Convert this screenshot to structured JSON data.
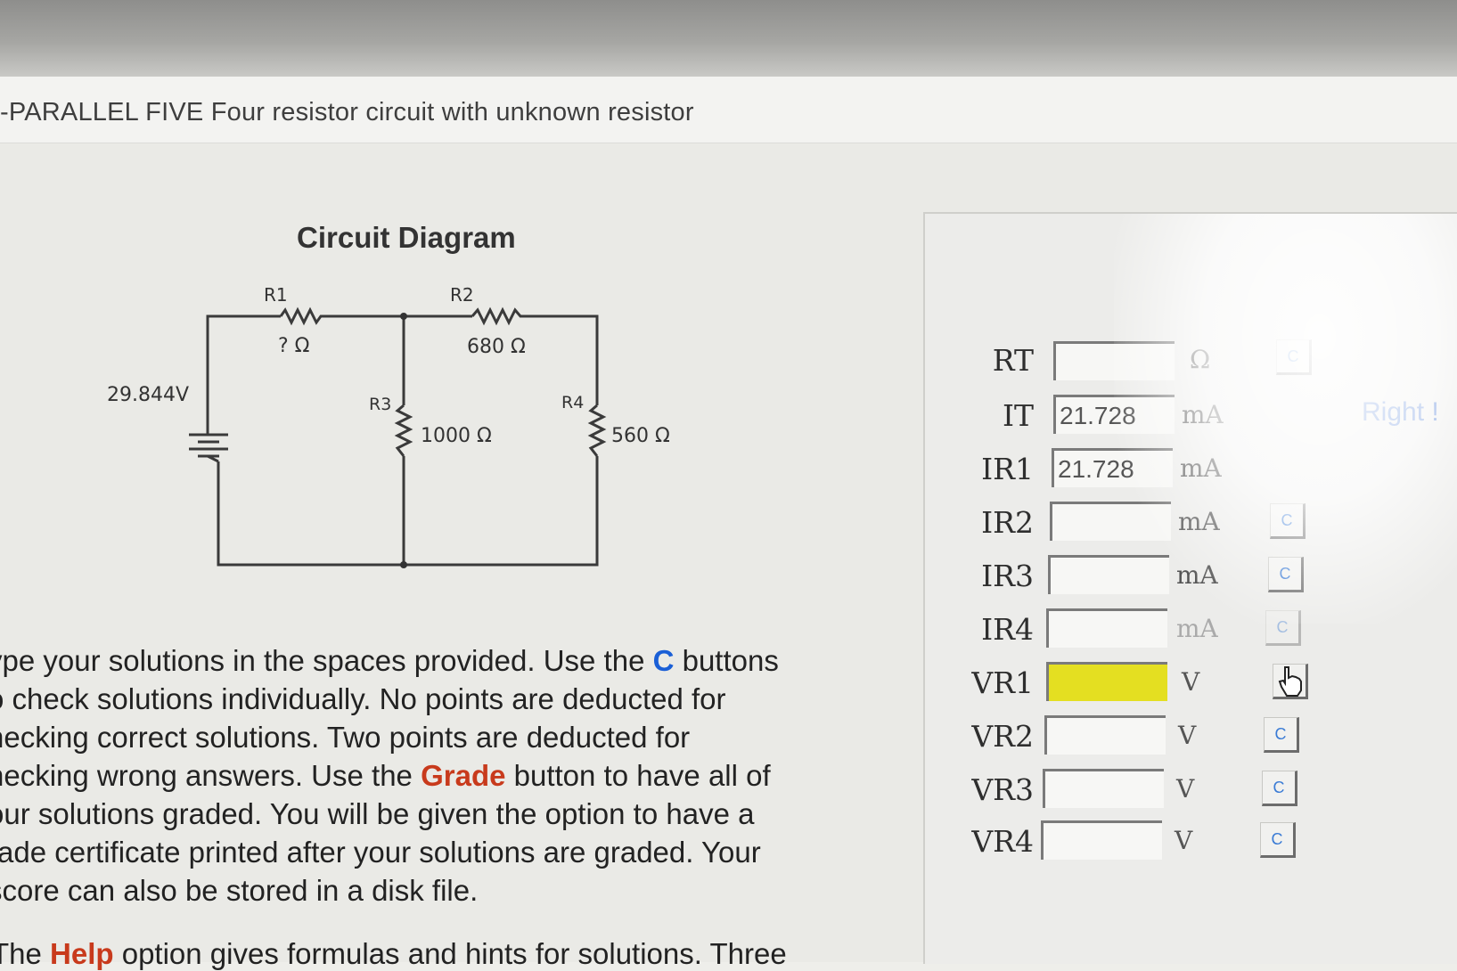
{
  "window": {
    "title": "-PARALLEL FIVE  Four resistor circuit with unknown resistor"
  },
  "diagram": {
    "title": "Circuit Diagram",
    "source_voltage": "29.844V",
    "resistors": [
      {
        "name": "R1",
        "value": "? Ω"
      },
      {
        "name": "R2",
        "value": "680 Ω"
      },
      {
        "name": "R3",
        "value": "1000 Ω"
      },
      {
        "name": "R4",
        "value": "560 Ω"
      }
    ]
  },
  "instructions": {
    "l1a": "ype your solutions in the spaces provided. Use the ",
    "c": "C",
    "l1b": " buttons",
    "l2": "o check solutions individually. No points are deducted for",
    "l3": "hecking correct solutions. Two points are deducted for",
    "l4a": "hecking wrong answers. Use the ",
    "grade": "Grade",
    "l4b": " button to have all of",
    "l5": "our solutions graded. You will be given the option to have a",
    "l6": "rade certificate printed after your solutions are graded. Your",
    "l7": "score can also be stored in a disk file.",
    "help_a": "The ",
    "help": "Help",
    "help_b": " option gives formulas and hints for solutions. Three"
  },
  "answers": [
    {
      "label": "RT",
      "value": "",
      "unit": "Ω",
      "button": "C"
    },
    {
      "label": "IT",
      "value": "21.728",
      "unit": "mA",
      "button": ""
    },
    {
      "label": "IR1",
      "value": "21.728",
      "unit": "mA",
      "button": ""
    },
    {
      "label": "IR2",
      "value": "",
      "unit": "mA",
      "button": "C"
    },
    {
      "label": "IR3",
      "value": "",
      "unit": "mA",
      "button": "C"
    },
    {
      "label": "IR4",
      "value": "",
      "unit": "mA",
      "button": "C"
    },
    {
      "label": "VR1",
      "value": "",
      "unit": "V",
      "button": ""
    },
    {
      "label": "VR2",
      "value": "",
      "unit": "V",
      "button": "C"
    },
    {
      "label": "VR3",
      "value": "",
      "unit": "V",
      "button": "C"
    },
    {
      "label": "VR4",
      "value": "",
      "unit": "V",
      "button": "C"
    }
  ],
  "feedback": "Right !",
  "icons": {
    "cursor": "hand-pointer-icon",
    "battery": "battery-icon",
    "resistor": "resistor-icon"
  },
  "colors": {
    "active_field": "#e4df21",
    "c_button_text": "#3a7bd5",
    "feedback": "#3b6fd1"
  }
}
